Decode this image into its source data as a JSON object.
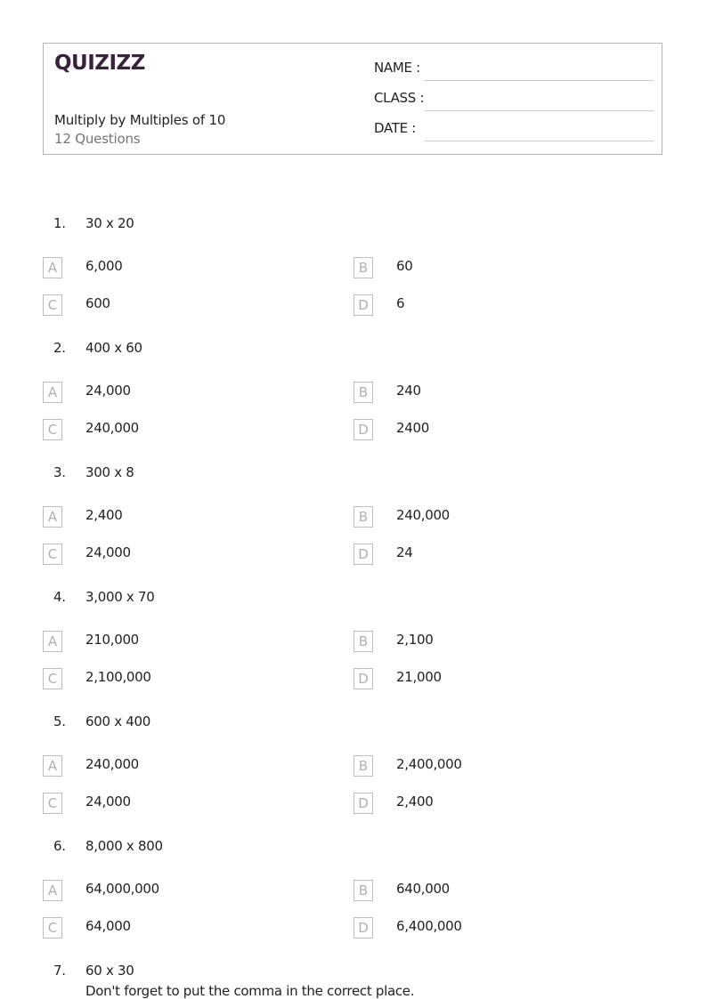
{
  "header": {
    "logo": "QUIZIZZ",
    "title": "Multiply by Multiples of 10",
    "question_count": "12 Questions",
    "fields": [
      {
        "label": "NAME :"
      },
      {
        "label": "CLASS :"
      },
      {
        "label": "DATE  :"
      }
    ]
  },
  "questions": [
    {
      "number": "1.",
      "text": "30 x 20",
      "options": [
        {
          "letter": "A",
          "text": "6,000"
        },
        {
          "letter": "B",
          "text": "60"
        },
        {
          "letter": "C",
          "text": "600"
        },
        {
          "letter": "D",
          "text": "6"
        }
      ]
    },
    {
      "number": "2.",
      "text": "400 x 60",
      "options": [
        {
          "letter": "A",
          "text": "24,000"
        },
        {
          "letter": "B",
          "text": "240"
        },
        {
          "letter": "C",
          "text": "240,000"
        },
        {
          "letter": "D",
          "text": "2400"
        }
      ]
    },
    {
      "number": "3.",
      "text": "300 x 8",
      "options": [
        {
          "letter": "A",
          "text": "2,400"
        },
        {
          "letter": "B",
          "text": "240,000"
        },
        {
          "letter": "C",
          "text": "24,000"
        },
        {
          "letter": "D",
          "text": "24"
        }
      ]
    },
    {
      "number": "4.",
      "text": "3,000 x 70",
      "options": [
        {
          "letter": "A",
          "text": "210,000"
        },
        {
          "letter": "B",
          "text": "2,100"
        },
        {
          "letter": "C",
          "text": "2,100,000"
        },
        {
          "letter": "D",
          "text": "21,000"
        }
      ]
    },
    {
      "number": "5.",
      "text": "600 x 400",
      "options": [
        {
          "letter": "A",
          "text": "240,000"
        },
        {
          "letter": "B",
          "text": "2,400,000"
        },
        {
          "letter": "C",
          "text": "24,000"
        },
        {
          "letter": "D",
          "text": "2,400"
        }
      ]
    },
    {
      "number": "6.",
      "text": "8,000 x 800",
      "options": [
        {
          "letter": "A",
          "text": "64,000,000"
        },
        {
          "letter": "B",
          "text": "640,000"
        },
        {
          "letter": "C",
          "text": "64,000"
        },
        {
          "letter": "D",
          "text": "6,400,000"
        }
      ]
    },
    {
      "number": "7.",
      "text": "60 x 30",
      "hint": "Don't forget to put the comma in the correct place.",
      "options": []
    }
  ]
}
